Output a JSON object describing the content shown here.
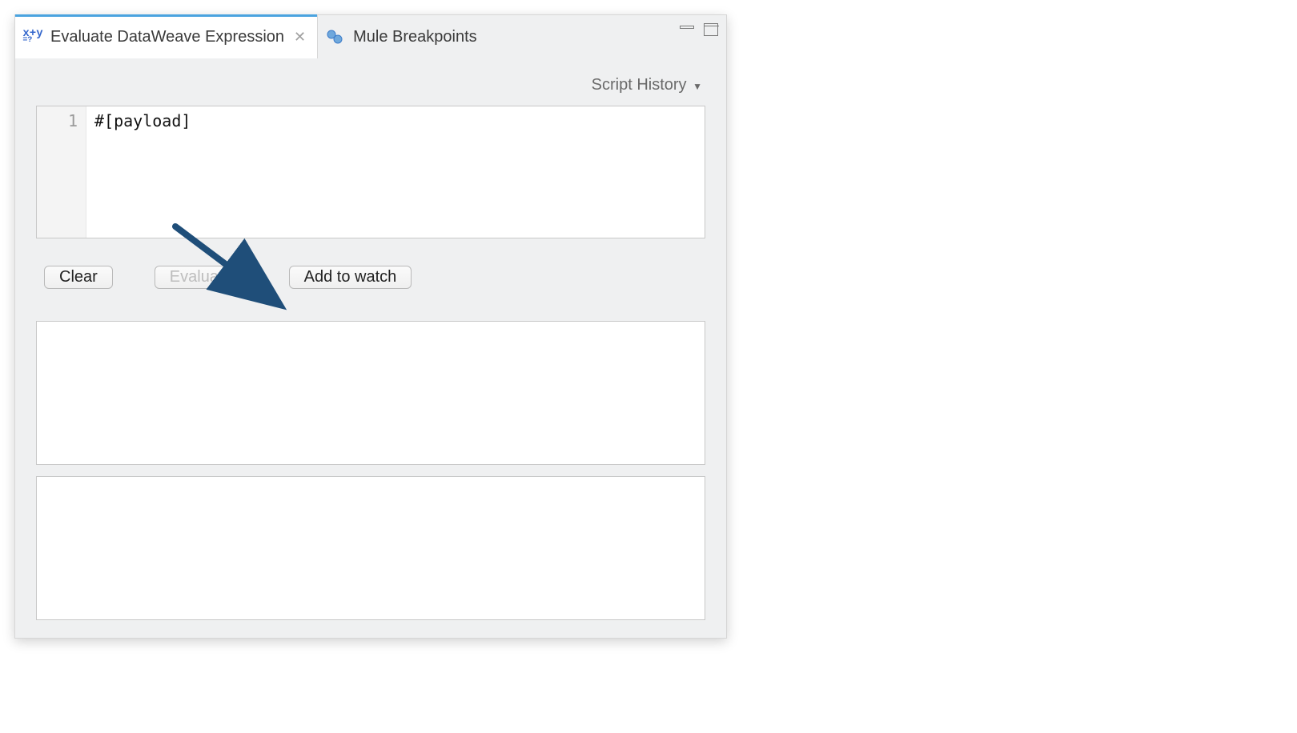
{
  "tabs": {
    "evaluate": {
      "label": "Evaluate DataWeave Expression"
    },
    "breakpoints": {
      "label": "Mule Breakpoints"
    }
  },
  "dropdown": {
    "script_history_label": "Script History"
  },
  "editor": {
    "line_number": "1",
    "code": "#[payload]"
  },
  "buttons": {
    "clear": "Clear",
    "evaluate": "Evaluate",
    "add_to_watch": "Add to watch"
  }
}
